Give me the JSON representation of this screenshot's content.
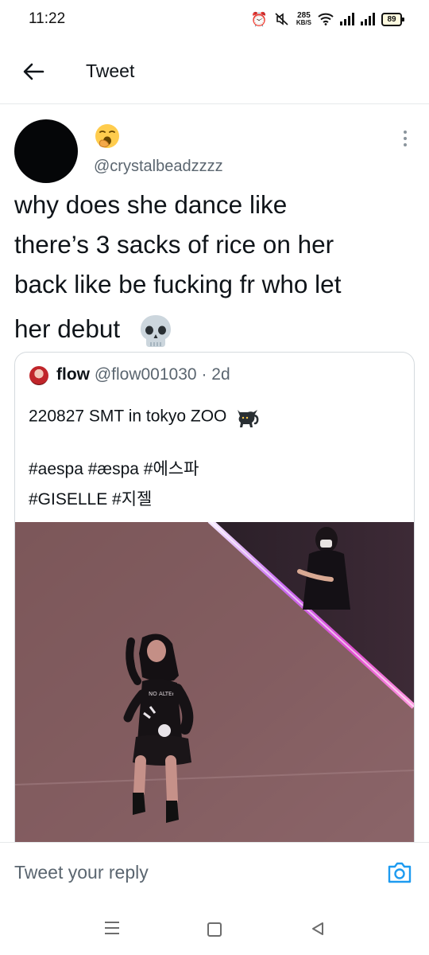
{
  "status_bar": {
    "time": "11:22",
    "speed_value": "285",
    "speed_unit": "KB/S",
    "battery": "89"
  },
  "header": {
    "title": "Tweet",
    "back_icon": "arrow-left-icon"
  },
  "tweet": {
    "display_name_emoji": "yawning-face-emoji",
    "handle": "@crystalbeadzzzz",
    "text_lines": [
      "why does she dance like",
      "there’s 3 sacks of rice on her",
      "back like be fucking fr who let",
      "her debut"
    ],
    "trailing_emoji": "skull-emoji"
  },
  "quoted": {
    "name": "flow",
    "handle": "@flow001030",
    "separator": "·",
    "time": "2d",
    "line1": "220827 SMT in tokyo ZOO",
    "line1_emoji": "black-cat-emoji",
    "line2": "#aespa #æspa #에스파",
    "line3": "#GISELLE #지젤",
    "media": "video-still-performer-on-stage"
  },
  "reply": {
    "placeholder": "Tweet your reply",
    "camera_icon": "camera-icon"
  },
  "colors": {
    "text": "#0f1419",
    "muted": "#5b6670",
    "accent": "#1d9bf0",
    "divider": "#e6e9eb"
  }
}
